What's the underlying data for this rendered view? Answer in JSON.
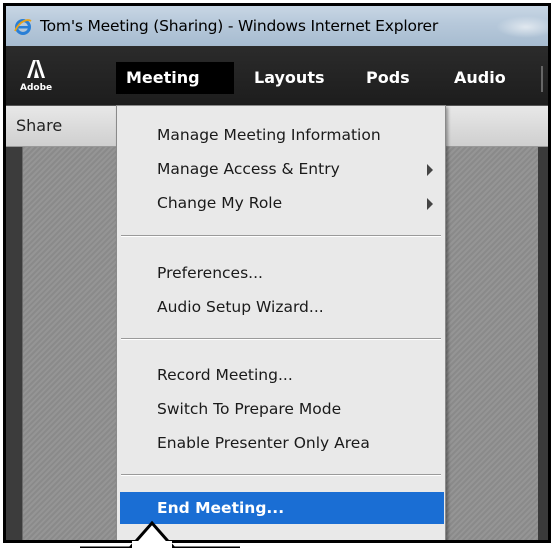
{
  "window": {
    "title": "Tom's Meeting (Sharing) - Windows Internet Explorer"
  },
  "menubar": {
    "logo_text": "Adobe",
    "items": [
      {
        "label": "Meeting"
      },
      {
        "label": "Layouts"
      },
      {
        "label": "Pods"
      },
      {
        "label": "Audio"
      }
    ]
  },
  "pod": {
    "title": "Share"
  },
  "dropdown": {
    "items": [
      {
        "label": "Manage Meeting Information"
      },
      {
        "label": "Manage Access & Entry"
      },
      {
        "label": "Change My Role"
      },
      {
        "label": "Preferences..."
      },
      {
        "label": "Audio Setup Wizard..."
      },
      {
        "label": "Record Meeting..."
      },
      {
        "label": "Switch To Prepare Mode"
      },
      {
        "label": "Enable Presenter Only Area"
      },
      {
        "label": "End Meeting..."
      }
    ]
  },
  "colors": {
    "highlight": "#1a6ed4",
    "menubar_bg": "#1d1d1d",
    "active_menu_bg": "#000000"
  }
}
